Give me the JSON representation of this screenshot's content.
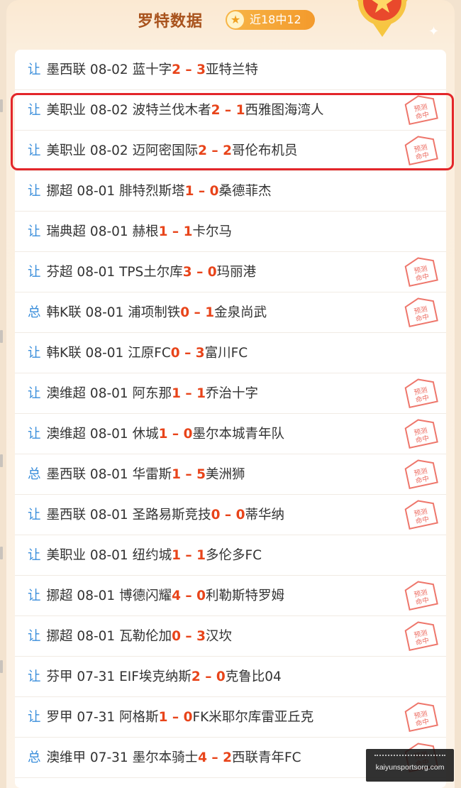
{
  "header": {
    "title": "罗特数据",
    "badge": "近18中12"
  },
  "stamp_label": "预测命中",
  "watermark": "kaiyunsportsorg.com",
  "matches": [
    {
      "kind": "让",
      "league": "墨西联",
      "date": "08-02",
      "home": "蓝十字",
      "hs": "2",
      "as": "3",
      "away": "亚特兰特",
      "hit": false
    },
    {
      "kind": "让",
      "league": "美职业",
      "date": "08-02",
      "home": "波特兰伐木者",
      "hs": "2",
      "as": "1",
      "away": "西雅图海湾人",
      "hit": true
    },
    {
      "kind": "让",
      "league": "美职业",
      "date": "08-02",
      "home": "迈阿密国际",
      "hs": "2",
      "as": "2",
      "away": "哥伦布机员",
      "hit": true
    },
    {
      "kind": "让",
      "league": "挪超",
      "date": "08-01",
      "home": "腓特烈斯塔",
      "hs": "1",
      "as": "0",
      "away": "桑德菲杰",
      "hit": false
    },
    {
      "kind": "让",
      "league": "瑞典超",
      "date": "08-01",
      "home": "赫根",
      "hs": "1",
      "as": "1",
      "away": "卡尔马",
      "hit": false
    },
    {
      "kind": "让",
      "league": "芬超",
      "date": "08-01",
      "home": "TPS土尔库",
      "hs": "3",
      "as": "0",
      "away": "玛丽港",
      "hit": true
    },
    {
      "kind": "总",
      "league": "韩K联",
      "date": "08-01",
      "home": "浦项制铁",
      "hs": "0",
      "as": "1",
      "away": "金泉尚武",
      "hit": true
    },
    {
      "kind": "让",
      "league": "韩K联",
      "date": "08-01",
      "home": "江原FC",
      "hs": "0",
      "as": "3",
      "away": "富川FC",
      "hit": false
    },
    {
      "kind": "让",
      "league": "澳维超",
      "date": "08-01",
      "home": "阿东那",
      "hs": "1",
      "as": "1",
      "away": "乔治十字",
      "hit": true
    },
    {
      "kind": "让",
      "league": "澳维超",
      "date": "08-01",
      "home": "休城",
      "hs": "1",
      "as": "0",
      "away": "墨尔本城青年队",
      "hit": true
    },
    {
      "kind": "总",
      "league": "墨西联",
      "date": "08-01",
      "home": "华雷斯",
      "hs": "1",
      "as": "5",
      "away": "美洲狮",
      "hit": true
    },
    {
      "kind": "让",
      "league": "墨西联",
      "date": "08-01",
      "home": "圣路易斯竞技",
      "hs": "0",
      "as": "0",
      "away": "蒂华纳",
      "hit": true
    },
    {
      "kind": "让",
      "league": "美职业",
      "date": "08-01",
      "home": "纽约城",
      "hs": "1",
      "as": "1",
      "away": "多伦多FC",
      "hit": false
    },
    {
      "kind": "让",
      "league": "挪超",
      "date": "08-01",
      "home": "博德闪耀",
      "hs": "4",
      "as": "0",
      "away": "利勒斯特罗姆",
      "hit": true
    },
    {
      "kind": "让",
      "league": "挪超",
      "date": "08-01",
      "home": "瓦勒伦加",
      "hs": "0",
      "as": "3",
      "away": "汉坎",
      "hit": true
    },
    {
      "kind": "让",
      "league": "芬甲",
      "date": "07-31",
      "home": "EIF埃克纳斯",
      "hs": "2",
      "as": "0",
      "away": "克鲁比04",
      "hit": false
    },
    {
      "kind": "让",
      "league": "罗甲",
      "date": "07-31",
      "home": "阿格斯",
      "hs": "1",
      "as": "0",
      "away": "FK米耶尔库雷亚丘克",
      "hit": true
    },
    {
      "kind": "总",
      "league": "澳维甲",
      "date": "07-31",
      "home": "墨尔本骑士",
      "hs": "4",
      "as": "2",
      "away": "西联青年FC",
      "hit": true
    }
  ]
}
